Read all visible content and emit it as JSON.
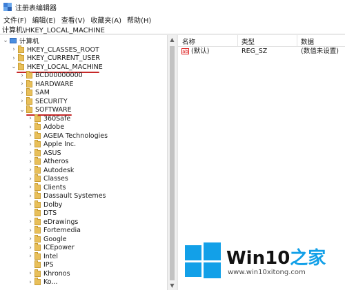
{
  "window": {
    "title": "注册表编辑器",
    "address": "计算机\\HKEY_LOCAL_MACHINE"
  },
  "menu": [
    "文件(F)",
    "编辑(E)",
    "查看(V)",
    "收藏夹(A)",
    "帮助(H)"
  ],
  "tree": {
    "root": "计算机",
    "hives": [
      "HKEY_CLASSES_ROOT",
      "HKEY_CURRENT_USER",
      "HKEY_LOCAL_MACHINE"
    ],
    "hklm_children": [
      "BCD00000000",
      "HARDWARE",
      "SAM",
      "SECURITY",
      "SOFTWARE"
    ],
    "software_children": [
      "360Safe",
      "Adobe",
      "AGEIA Technologies",
      "Apple Inc.",
      "ASUS",
      "Atheros",
      "Autodesk",
      "Classes",
      "Clients",
      "Dassault Systemes",
      "Dolby",
      "DTS",
      "eDrawings",
      "Fortemedia",
      "Google",
      "ICEpower",
      "Intel",
      "IPS",
      "Khronos",
      "Ko..."
    ]
  },
  "list": {
    "headers": [
      "名称",
      "类型",
      "数据"
    ],
    "rows": [
      {
        "name": "(默认)",
        "type": "REG_SZ",
        "data": "(数值未设置)",
        "icon": "ab"
      }
    ]
  },
  "annotations": {
    "underline_color": "#c62828"
  },
  "watermark": {
    "title_part1": "Win10",
    "title_part2": "之家",
    "url": "www.win10xitong.com",
    "brand_color": "#12a0e8"
  }
}
